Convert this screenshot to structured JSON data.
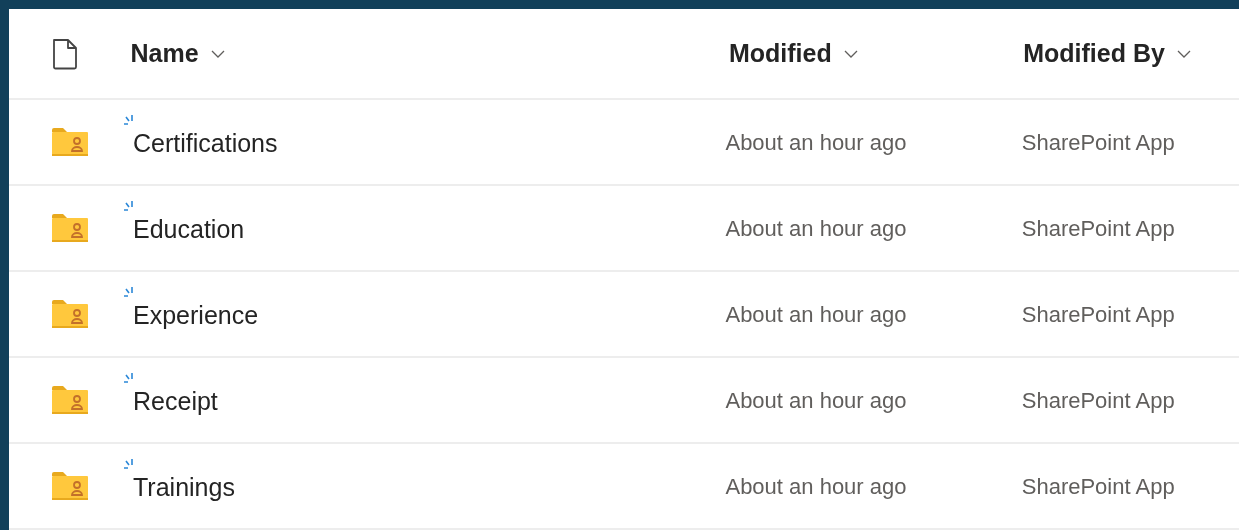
{
  "columns": [
    {
      "label": "Name",
      "kind": "name"
    },
    {
      "label": "Modified",
      "kind": "modified"
    },
    {
      "label": "Modified By",
      "kind": "modified_by"
    }
  ],
  "rows": [
    {
      "name": "Certifications",
      "modified": "About an hour ago",
      "modified_by": "SharePoint App",
      "new": true
    },
    {
      "name": "Education",
      "modified": "About an hour ago",
      "modified_by": "SharePoint App",
      "new": true
    },
    {
      "name": "Experience",
      "modified": "About an hour ago",
      "modified_by": "SharePoint App",
      "new": true
    },
    {
      "name": "Receipt",
      "modified": "About an hour ago",
      "modified_by": "SharePoint App",
      "new": true
    },
    {
      "name": "Trainings",
      "modified": "About an hour ago",
      "modified_by": "SharePoint App",
      "new": true
    }
  ]
}
